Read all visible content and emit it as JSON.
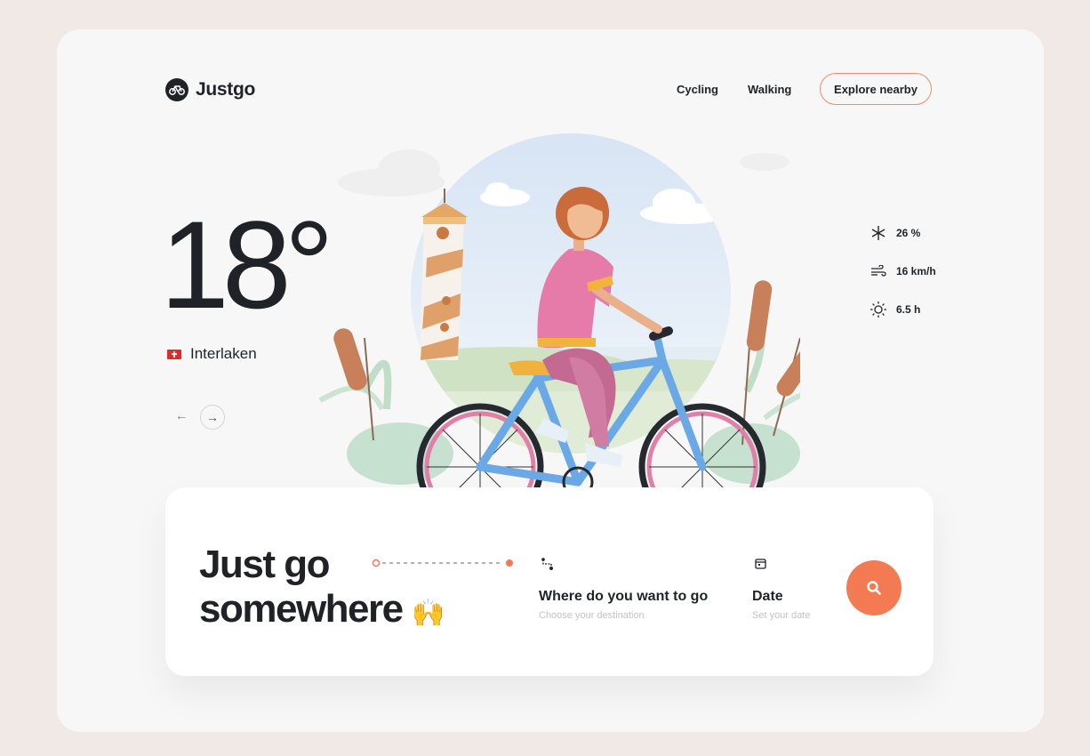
{
  "brand": {
    "name": "Justgo"
  },
  "nav": {
    "cycling": "Cycling",
    "walking": "Walking",
    "explore": "Explore nearby"
  },
  "weather": {
    "temperature": "18°",
    "location": "Interlaken",
    "stats": [
      {
        "icon": "snowflake-icon",
        "value": "26 %"
      },
      {
        "icon": "wind-icon",
        "value": "16 km/h"
      },
      {
        "icon": "sun-icon",
        "value": "6.5 h"
      }
    ]
  },
  "search": {
    "headline_line1": "Just go",
    "headline_line2": "somewhere",
    "destination_label": "Where do you want to go",
    "destination_hint": "Choose your destination",
    "date_label": "Date",
    "date_hint": "Set your date"
  },
  "colors": {
    "accent": "#f47a54",
    "text": "#1f2328",
    "background": "#f1e9e5",
    "card": "#f7f7f7"
  }
}
